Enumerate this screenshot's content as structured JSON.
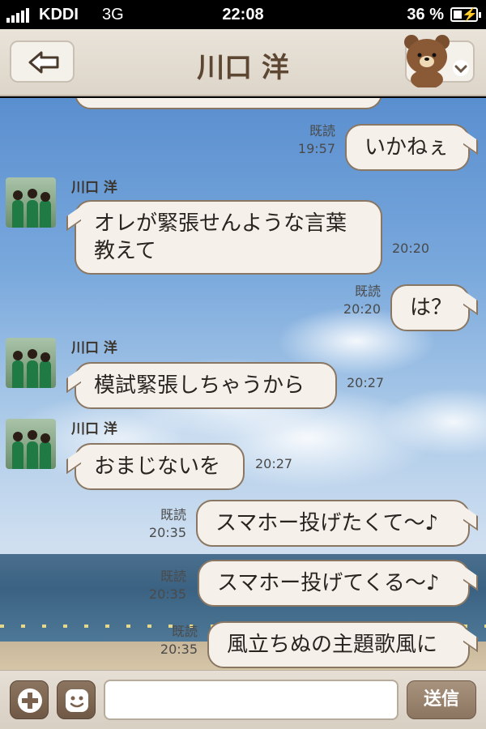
{
  "status_bar": {
    "carrier": "KDDI",
    "network": "3G",
    "time": "22:08",
    "battery": "36 %"
  },
  "header": {
    "title": "川口 洋",
    "back_icon": "arrow-left-icon",
    "menu_icon": "chevron-down-icon"
  },
  "messages": [
    {
      "side": "right",
      "text": "いかねぇ",
      "read": "既読",
      "time": "19:57"
    },
    {
      "side": "left",
      "sender": "川口 洋",
      "lines": [
        "オレが緊張せんような言葉",
        "教えて"
      ],
      "time": "20:20"
    },
    {
      "side": "right",
      "text": "は？",
      "read": "既読",
      "time": "20:20"
    },
    {
      "side": "left",
      "sender": "川口 洋",
      "text": "模試緊張しちゃうから",
      "time": "20:27"
    },
    {
      "side": "left",
      "sender": "川口 洋",
      "text": "おまじないを",
      "time": "20:27"
    },
    {
      "side": "right",
      "text": "スマホー投げたくて〜♪",
      "read": "既読",
      "time": "20:35"
    },
    {
      "side": "right",
      "text": "スマホー投げてくる〜♪",
      "read": "既読",
      "time": "20:35"
    },
    {
      "side": "right",
      "text": "風立ちぬの主題歌風に",
      "read": "既読",
      "time": "20:35"
    }
  ],
  "input_bar": {
    "add_icon": "plus-icon",
    "sticker_icon": "smiley-icon",
    "message_value": "",
    "send_label": "送信"
  },
  "colors": {
    "header_bg": "#e3dcd1",
    "title": "#5d4733",
    "bubble_bg": "#f5f1ea",
    "bubble_border": "#8a7763",
    "send_button": "#9a8470"
  }
}
